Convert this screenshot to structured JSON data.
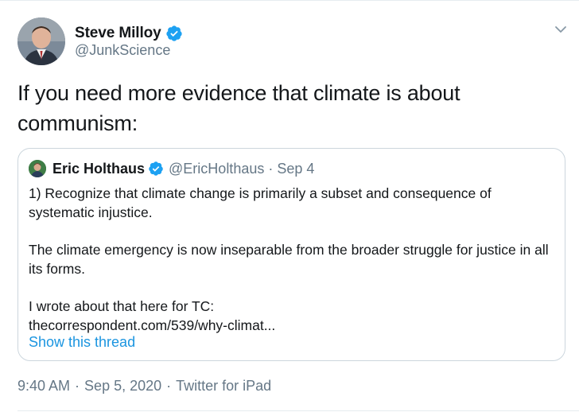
{
  "author": {
    "name": "Steve Milloy",
    "handle": "@JunkScience",
    "verified": true
  },
  "tweet": {
    "text": "If you need more evidence that climate is about communism:"
  },
  "quoted_tweet": {
    "author_name": "Eric Holthaus",
    "handle": "@EricHolthaus",
    "separator": "·",
    "date": "Sep 4",
    "verified": true,
    "paragraphs": [
      "1) Recognize that climate change is primarily a subset and consequence of systematic injustice.",
      "The climate emergency is now inseparable from the broader struggle for justice in all its forms."
    ],
    "intro_line": "I wrote about that here for TC:",
    "link_text": "thecorrespondent.com/539/why-climat...",
    "show_thread": "Show this thread"
  },
  "footer": {
    "time": "9:40 AM",
    "separator": "·",
    "date": "Sep 5, 2020",
    "source": "Twitter for iPad"
  },
  "colors": {
    "text": "#14171a",
    "secondary": "#657786",
    "link": "#1b95e0",
    "verified": "#1da1f2",
    "border": "#ccd6dd"
  },
  "icons": {
    "verified": "verified-badge-icon",
    "caret": "chevron-down-icon"
  }
}
